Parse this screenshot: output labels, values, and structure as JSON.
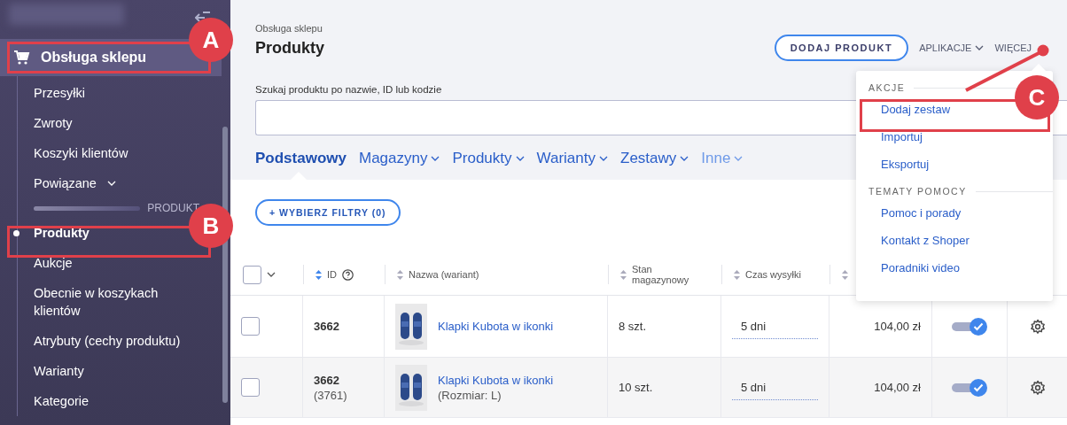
{
  "sidebar": {
    "section": {
      "label": "Obsługa sklepu",
      "selected": true
    },
    "items": [
      {
        "kind": "link",
        "label": "Przesyłki",
        "selected": false
      },
      {
        "kind": "link",
        "label": "Zwroty",
        "selected": false
      },
      {
        "kind": "link",
        "label": "Koszyki klientów",
        "selected": false
      },
      {
        "kind": "expandable",
        "label": "Powiązane",
        "selected": false
      },
      {
        "kind": "divider",
        "label": "PRODUKT"
      },
      {
        "kind": "link",
        "label": "Produkty",
        "selected": true
      },
      {
        "kind": "link",
        "label": "Aukcje",
        "selected": false
      },
      {
        "kind": "link",
        "label": "Obecnie w koszykach klientów",
        "selected": false
      },
      {
        "kind": "link",
        "label": "Atrybuty (cechy produktu)",
        "selected": false
      },
      {
        "kind": "link",
        "label": "Warianty",
        "selected": false
      },
      {
        "kind": "link",
        "label": "Kategorie",
        "selected": false
      }
    ]
  },
  "header": {
    "breadcrumb": "Obsługa sklepu",
    "title": "Produkty",
    "primary_button": "DODAJ PRODUKT",
    "menus": [
      {
        "label": "APLIKACJE",
        "caret": true
      },
      {
        "label": "WIĘCEJ",
        "caret": false
      }
    ]
  },
  "search": {
    "label": "Szukaj produktu po nazwie, ID lub kodzie"
  },
  "tabs": [
    {
      "label": "Podstawowy",
      "selected": true,
      "disabled": false,
      "caret": false
    },
    {
      "label": "Magazyny",
      "selected": false,
      "disabled": false,
      "caret": true
    },
    {
      "label": "Produkty",
      "selected": false,
      "disabled": false,
      "caret": true
    },
    {
      "label": "Warianty",
      "selected": false,
      "disabled": false,
      "caret": true
    },
    {
      "label": "Zestawy",
      "selected": false,
      "disabled": false,
      "caret": true
    },
    {
      "label": "Inne",
      "selected": false,
      "disabled": true,
      "caret": true
    }
  ],
  "filter_button": "+ WYBIERZ FILTRY (0)",
  "table": {
    "select_all": {
      "checked": false
    },
    "columns": [
      {
        "kind": "id",
        "label": "ID"
      },
      {
        "kind": "name",
        "label": "Nazwa (wariant)"
      },
      {
        "kind": "stock",
        "label": "Stan magazynowy"
      },
      {
        "kind": "shipping",
        "label": "Czas wysyłki"
      },
      {
        "kind": "price"
      }
    ],
    "rows": [
      {
        "checked": false,
        "id": "3662",
        "name": "Klapki Kubota w ikonki",
        "stock": "8 szt.",
        "shipping": "5 dni",
        "price": "104,00 zł",
        "on": true
      },
      {
        "checked": false,
        "id": "3662",
        "variant_id": "(3761)",
        "name": "Klapki Kubota w ikonki",
        "variant": "(Rozmiar: L)",
        "stock": "10 szt.",
        "shipping": "5 dni",
        "price": "104,00 zł",
        "on": true
      }
    ]
  },
  "dropdown": {
    "groups": [
      {
        "title": "AKCJE",
        "items": [
          {
            "label": "Dodaj zestaw"
          },
          {
            "label": "Importuj"
          },
          {
            "label": "Eksportuj"
          }
        ]
      },
      {
        "title": "TEMATY POMOCY",
        "items": [
          {
            "label": "Pomoc i porady"
          },
          {
            "label": "Kontakt z Shoper"
          },
          {
            "label": "Poradniki video"
          }
        ]
      }
    ]
  },
  "annotations": [
    {
      "letter": "A"
    },
    {
      "letter": "B"
    },
    {
      "letter": "C"
    }
  ]
}
